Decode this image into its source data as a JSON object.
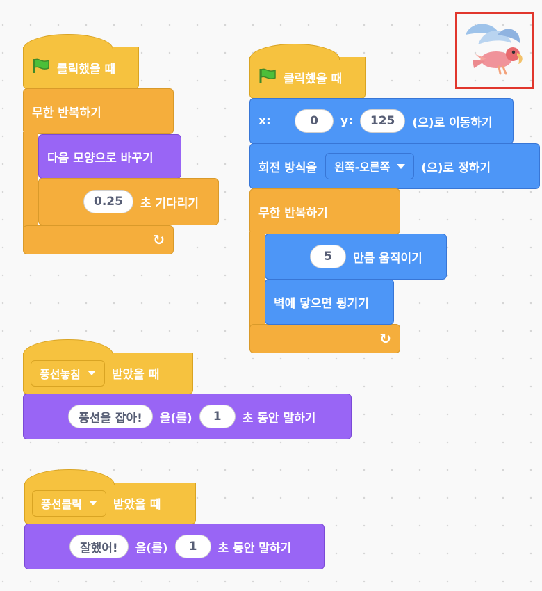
{
  "sprite": {
    "icon": "parrot-sprite-icon",
    "selected_color": "#e1372d"
  },
  "colors": {
    "event": "#f6c23f",
    "control": "#f5ae3c",
    "motion": "#4d96f7",
    "looks": "#9965f5"
  },
  "script1": {
    "hat": "클릭했을 때",
    "forever": "무한 반복하기",
    "next_costume": "다음 모양으로 바꾸기",
    "wait_value": "0.25",
    "wait_label": "초 기다리기"
  },
  "script2": {
    "hat": "클릭했을 때",
    "goto_x_label": "x:",
    "goto_x": "0",
    "goto_y_label": "y:",
    "goto_y": "125",
    "goto_suffix": "(으)로 이동하기",
    "rotation_label": "회전 방식을",
    "rotation_value": "왼쪽-오른쪽",
    "rotation_suffix": "(으)로 정하기",
    "forever": "무한 반복하기",
    "move_value": "5",
    "move_label": "만큼 움직이기",
    "bounce": "벽에 닿으면 튕기기"
  },
  "script3": {
    "message": "풍선놓침",
    "hat_suffix": "받았을 때",
    "say_text": "풍선을 잡아!",
    "say_mid": "을(를)",
    "say_secs": "1",
    "say_suffix": "초 동안 말하기"
  },
  "script4": {
    "message": "풍선클릭",
    "hat_suffix": "받았을 때",
    "say_text": "잘했어!",
    "say_mid": "을(를)",
    "say_secs": "1",
    "say_suffix": "초 동안 말하기"
  }
}
